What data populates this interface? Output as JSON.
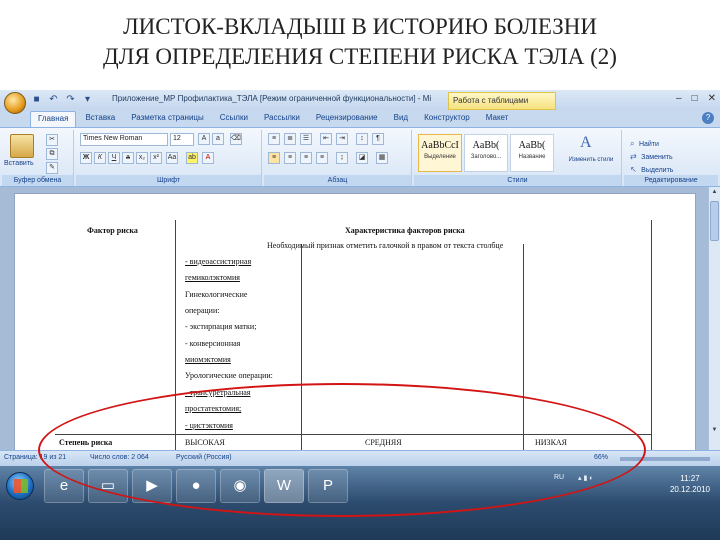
{
  "slide": {
    "title_line1": "ЛИСТОК-ВКЛАДЫШ В ИСТОРИЮ БОЛЕЗНИ",
    "title_line2": "ДЛЯ ОПРЕДЕЛЕНИЯ СТЕПЕНИ РИСКА ТЭЛА (2)"
  },
  "window": {
    "title": "Приложение_МР Профилактика_ТЭЛА [Режим ограниченной функциональности] - Mi",
    "context_tab": "Работа с таблицами",
    "controls": [
      "–",
      "□",
      "✕"
    ]
  },
  "tabs": [
    {
      "label": "Главная",
      "active": true
    },
    {
      "label": "Вставка"
    },
    {
      "label": "Разметка страницы"
    },
    {
      "label": "Ссылки"
    },
    {
      "label": "Рассылки"
    },
    {
      "label": "Рецензирование"
    },
    {
      "label": "Вид"
    },
    {
      "label": "Конструктор"
    },
    {
      "label": "Макет"
    }
  ],
  "ribbon": {
    "clipboard": {
      "paste_label": "Вставить",
      "group_label": "Буфер обмена"
    },
    "font": {
      "font_name": "Times New Roman",
      "font_size": "12",
      "group_label": "Шрифт"
    },
    "paragraph": {
      "group_label": "Абзац"
    },
    "styles": {
      "group_label": "Стили",
      "items": [
        {
          "sample": "AaBbCcI",
          "name": "Выделение"
        },
        {
          "sample": "AaBb(",
          "name": "Заголово..."
        },
        {
          "sample": "AaBb(",
          "name": "Название"
        }
      ],
      "change_styles": "Изменить стили"
    },
    "editing": {
      "group_label": "Редактирование",
      "find": "Найти",
      "replace": "Заменить",
      "select": "Выделить"
    }
  },
  "document": {
    "header_factor": "Фактор риска",
    "header_characteristics": "Характеристика факторов риска",
    "subheader": "Необходимый признак отметить галочкой в правом от текста столбце",
    "left_column": [
      "- видеоассистирная",
      "гемиколэктомия",
      "Гинекологические",
      "операции:",
      "- экстирпация матки;",
      "- конверсионная",
      "миомэктомия",
      "Урологические операции:",
      "- трансуретральная",
      "простатектомия;",
      "- цистэктомия"
    ],
    "risk_row": {
      "label": "Степень риска",
      "high": "ВЫСОКАЯ",
      "medium": "СРЕДНЯЯ",
      "low": "НИЗКАЯ"
    }
  },
  "statusbar": {
    "pages": "Страница: 19 из 21",
    "words": "Число слов: 2 064",
    "language": "Русский (Россия)",
    "zoom": "66%"
  },
  "taskbar": {
    "tray_lang": "RU",
    "time": "11:27",
    "date": "20.12.2010"
  },
  "colors": {
    "annotation": "#d21414",
    "ribbon": "#d7e5f6",
    "taskbar": "#2c4b6e"
  }
}
